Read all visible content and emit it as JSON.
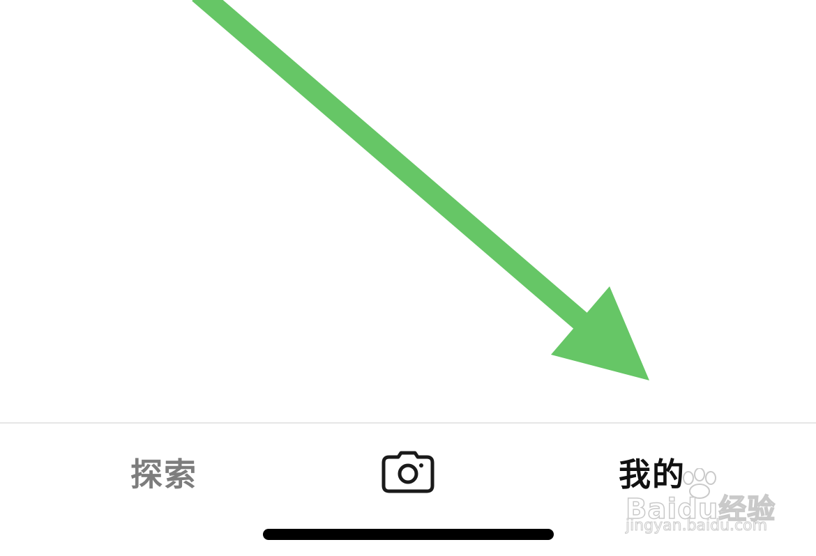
{
  "tab_bar": {
    "tabs": [
      {
        "label": "探索",
        "state": "inactive",
        "color": "#7d7d7d"
      },
      {
        "icon": "camera-icon",
        "state": "inactive"
      },
      {
        "label": "我的",
        "state": "active",
        "color": "#111111"
      }
    ]
  },
  "annotation": {
    "type": "arrow",
    "color": "#66c666",
    "points_to": "tab-mine"
  },
  "watermark": {
    "text": "Baidu经验",
    "url": "jingyan.baidu.com"
  }
}
